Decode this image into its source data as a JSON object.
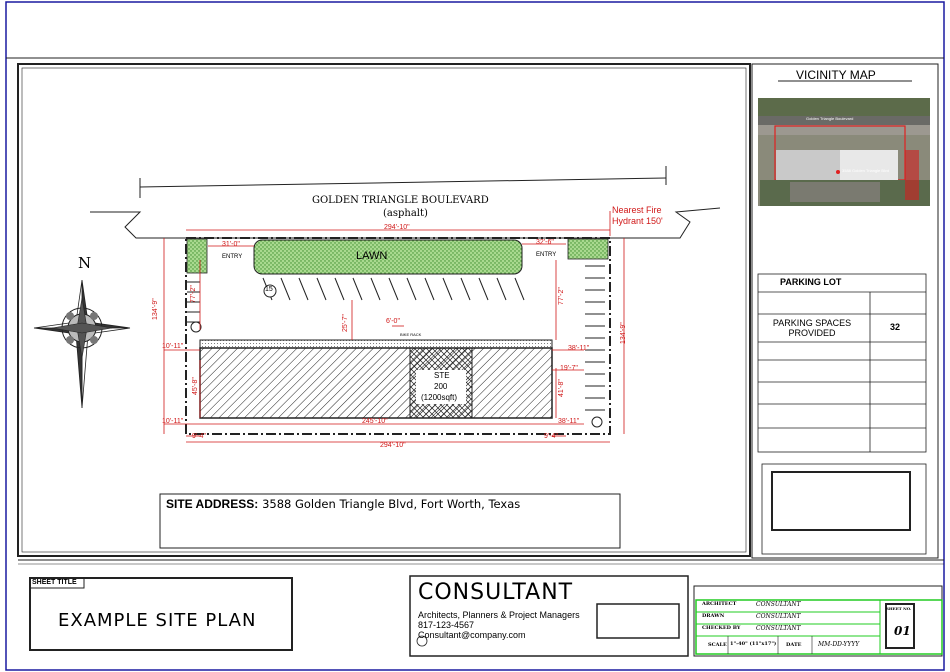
{
  "road": {
    "name": "GOLDEN TRIANGLE BOULEVARD",
    "surface": "(asphalt)"
  },
  "hydrant": {
    "line1": "Nearest Fire",
    "line2": "Hydrant 150'"
  },
  "north_label": "N",
  "lawn_label": "LAWN",
  "entries": {
    "left": "ENTRY",
    "right": "ENTRY"
  },
  "bike_rack": "BIKE RACK",
  "ste": {
    "line1": "STE",
    "line2": "200",
    "line3": "(1200sqft)"
  },
  "parking_count_marker": "15",
  "dimensions": {
    "top_total": "294'-10\"",
    "bottom_total": "294'-10\"",
    "left_entry": "31'-0\"",
    "right_entry": "32'-6\"",
    "left_height": "134'-9\"",
    "right_height": "134'-9\"",
    "left_row_a": "77'-2\"",
    "right_row_a": "77'-2\"",
    "center_drive": "25'-7\"",
    "bike_width": "6'-0\"",
    "building_right": "38'-11\"",
    "building_right_2": "38'-11\"",
    "building_left_a": "10'-11\"",
    "building_left_b": "10'-11\"",
    "building_height_left": "45'-8\"",
    "building_height_right": "41'-8\"",
    "ste_offset": "19'-7\"",
    "building_length": "245'-10\"",
    "left_setback": "9'-4\"",
    "right_setback": "9'-4\""
  },
  "site_address": {
    "label": "SITE ADDRESS:",
    "value": "3588 Golden Triangle Blvd, Fort Worth, Texas"
  },
  "vicinity": {
    "title": "VICINITY MAP",
    "road_label": "Golden Triangle Boulevard",
    "building_label": "3588 Golden Triangle Blvd"
  },
  "parking_table": {
    "title": "PARKING LOT",
    "row_label": "PARKING SPACES PROVIDED",
    "row_value": "32"
  },
  "sheet_title": {
    "caption": "SHEET TITLE",
    "value": "EXAMPLE SITE PLAN"
  },
  "consultant": {
    "name": "CONSULTANT",
    "line1": "Architects, Planners & Project Managers",
    "line2": "817-123-4567",
    "line3": "Consultant@company.com"
  },
  "title_block": {
    "architect_label": "ARCHITECT",
    "architect_value": "CONSULTANT",
    "drawn_label": "DRAWN",
    "drawn_value": "CONSULTANT",
    "checked_label": "CHECKED BY",
    "checked_value": "CONSULTANT",
    "scale_label": "SCALE",
    "scale_value": "1\"-40\" (11\"x17\")",
    "date_label": "DATE",
    "date_value": "MM-DD-YYYY",
    "sheet_no_label": "SHEET NO.",
    "sheet_no_value": "01"
  },
  "colors": {
    "border": "#1a1aa0",
    "dimension": "#d01818",
    "lawn": "#6fbf4f",
    "title_block_green": "#22cc22"
  }
}
